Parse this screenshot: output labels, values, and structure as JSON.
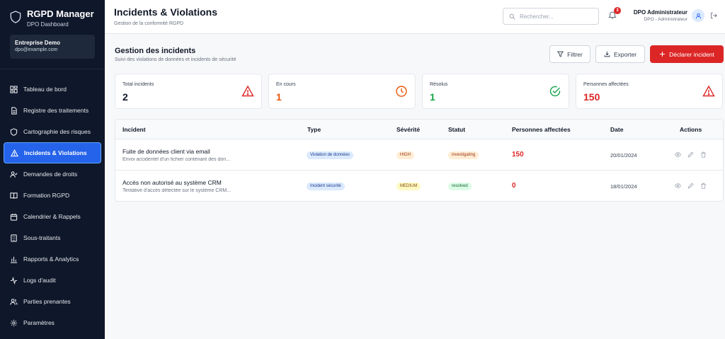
{
  "sidebar": {
    "brand_title": "RGPD Manager",
    "brand_subtitle": "DPO Dashboard",
    "org_name": "Entreprise Demo",
    "org_email": "dpo@example.com",
    "items": [
      {
        "label": "Tableau de bord",
        "icon": "grid-icon"
      },
      {
        "label": "Registre des traitements",
        "icon": "document-icon"
      },
      {
        "label": "Cartographie des risques",
        "icon": "shield-icon"
      },
      {
        "label": "Incidents & Violations",
        "icon": "warning-icon",
        "active": true
      },
      {
        "label": "Demandes de droits",
        "icon": "user-check-icon"
      },
      {
        "label": "Formation RGPD",
        "icon": "book-icon"
      },
      {
        "label": "Calendrier & Rappels",
        "icon": "calendar-icon"
      },
      {
        "label": "Sous-traitants",
        "icon": "building-icon"
      },
      {
        "label": "Rapports & Analytics",
        "icon": "bar-chart-icon"
      },
      {
        "label": "Logs d'audit",
        "icon": "activity-icon"
      },
      {
        "label": "Parties prenantes",
        "icon": "users-icon"
      },
      {
        "label": "Paramètres",
        "icon": "gear-icon"
      }
    ]
  },
  "header": {
    "title": "Incidents & Violations",
    "subtitle": "Gestion de la conformité RGPD",
    "search_placeholder": "Rechercher...",
    "notif_count": "3",
    "user_name": "DPO Administrateur",
    "user_role": "DPO - Administrateur"
  },
  "main": {
    "section_title": "Gestion des incidents",
    "section_subtitle": "Suivi des violations de données et incidents de sécurité",
    "filter_label": "Filtrer",
    "export_label": "Exporter",
    "declare_label": "Déclarer incident",
    "stats": [
      {
        "label": "Total incidents",
        "value": "2",
        "color": "#111827",
        "icon": "warning-icon",
        "icon_color": "#dc2626"
      },
      {
        "label": "En cours",
        "value": "1",
        "color": "#ea580c",
        "icon": "clock-icon",
        "icon_color": "#ea580c"
      },
      {
        "label": "Résolus",
        "value": "1",
        "color": "#16a34a",
        "icon": "check-circle-icon",
        "icon_color": "#16a34a"
      },
      {
        "label": "Personnes affectées",
        "value": "150",
        "color": "#dc2626",
        "icon": "warning-icon",
        "icon_color": "#dc2626"
      }
    ],
    "table": {
      "columns": [
        "Incident",
        "Type",
        "Sévérité",
        "Statut",
        "Personnes affectées",
        "Date",
        "Actions"
      ],
      "rows": [
        {
          "title": "Fuite de données client via email",
          "description": "Envoi accidentel d'un fichier contenant des don...",
          "type": "Violation de données",
          "severity": "HIGH",
          "status": "investigating",
          "people": "150",
          "date": "20/01/2024"
        },
        {
          "title": "Accès non autorisé au système CRM",
          "description": "Tentative d'accès détectée sur le système CRM...",
          "type": "Incident sécurité",
          "severity": "MEDIUM",
          "status": "resolved",
          "people": "0",
          "date": "18/01/2024"
        }
      ]
    }
  }
}
